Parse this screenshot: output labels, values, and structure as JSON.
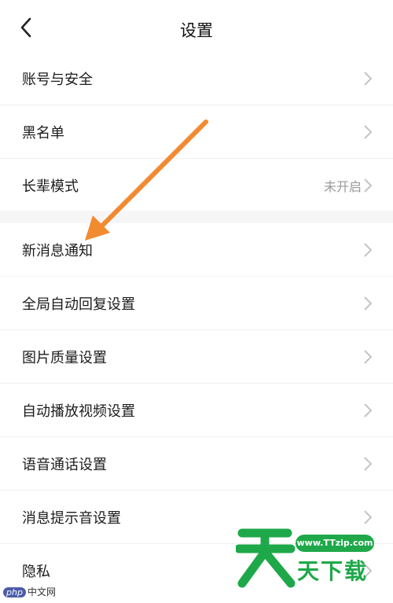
{
  "header": {
    "title": "设置"
  },
  "group1": [
    {
      "label": "账号与安全",
      "value": ""
    },
    {
      "label": "黑名单",
      "value": ""
    },
    {
      "label": "长辈模式",
      "value": "未开启"
    }
  ],
  "group2": [
    {
      "label": "新消息通知"
    },
    {
      "label": "全局自动回复设置"
    },
    {
      "label": "图片质量设置"
    },
    {
      "label": "自动播放视频设置"
    },
    {
      "label": "语音通话设置"
    },
    {
      "label": "消息提示音设置"
    },
    {
      "label": "隐私"
    }
  ],
  "colors": {
    "arrow": "#f28a30",
    "watermark": "#1fa84a",
    "chevron": "#c4c4c4"
  },
  "icons": {
    "back": "chevron-left-icon",
    "row": "chevron-right-icon"
  },
  "watermark": {
    "url": "www.TTzip.com",
    "slogan": "天下载",
    "php_badge": "php",
    "php_text": "中文网"
  }
}
